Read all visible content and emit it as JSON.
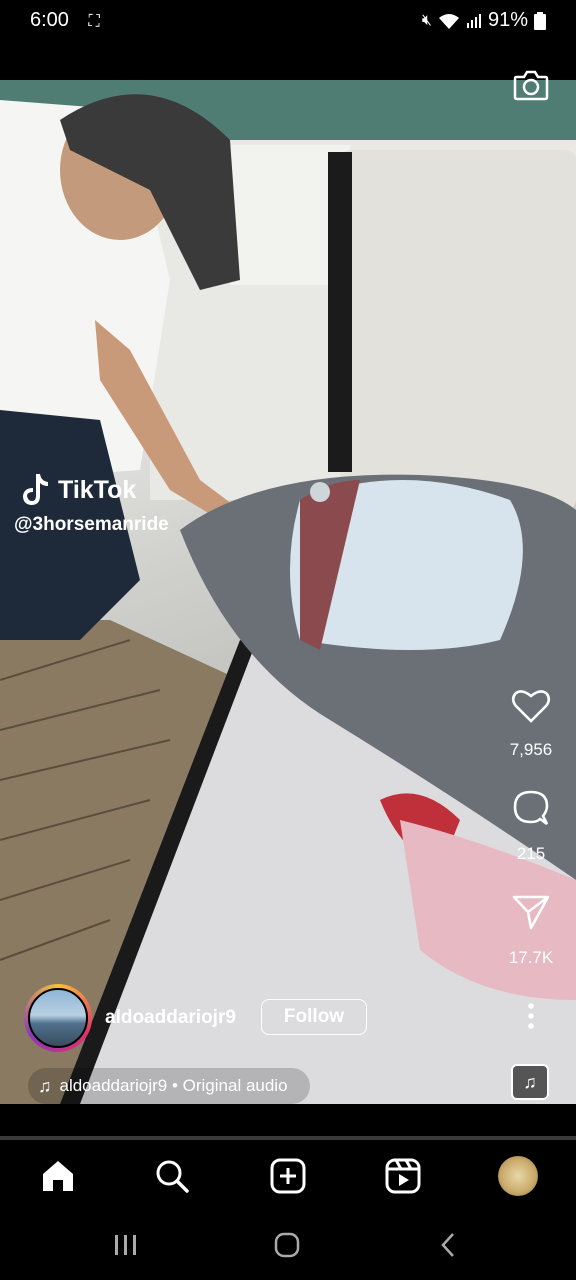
{
  "status_bar": {
    "time": "6:00",
    "battery": "91%"
  },
  "watermark": {
    "brand": "TikTok",
    "handle": "@3horsemanride"
  },
  "actions": {
    "likes": "7,956",
    "comments": "215",
    "shares": "17.7K"
  },
  "author": {
    "username": "aldoaddariojr9",
    "follow_label": "Follow"
  },
  "audio": {
    "label": "aldoaddariojr9 • Original audio"
  },
  "video": {
    "progress": 0.0
  },
  "nav": {
    "items": [
      "home-icon",
      "search-icon",
      "create-icon",
      "reels-icon",
      "profile-avatar"
    ]
  }
}
